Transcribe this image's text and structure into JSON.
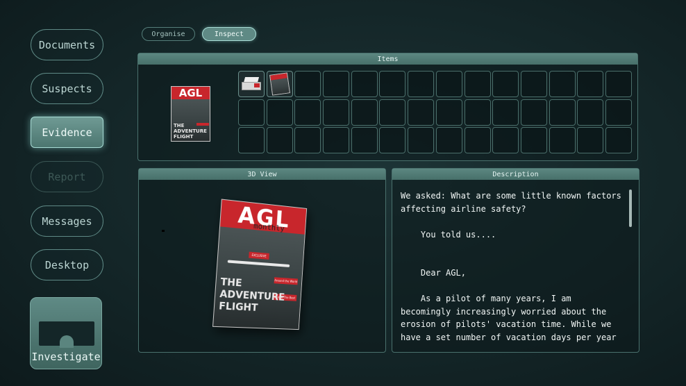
{
  "sidebar": {
    "items": [
      {
        "label": "Documents",
        "state": "normal"
      },
      {
        "label": "Suspects",
        "state": "normal"
      },
      {
        "label": "Evidence",
        "state": "active"
      },
      {
        "label": "Report",
        "state": "disabled"
      },
      {
        "label": "Messages",
        "state": "normal"
      },
      {
        "label": "Desktop",
        "state": "normal"
      }
    ],
    "investigate_label": "Investigate"
  },
  "tabs": {
    "organise": "Organise",
    "inspect": "Inspect",
    "selected": "Inspect"
  },
  "items_panel": {
    "title": "Items",
    "columns": 14,
    "rows": 3,
    "filled": [
      {
        "slot": 0,
        "icon": "printer-icon"
      },
      {
        "slot": 1,
        "icon": "magazine-icon"
      }
    ]
  },
  "magazine": {
    "masthead": "AGL",
    "subtitle": "monthly",
    "headline_1": "THE",
    "headline_2": "ADVENTURE",
    "headline_3": "FLIGHT",
    "tag_exclusive": "EXCLUSIVE",
    "tag_around": "Around the World",
    "tag_above": "Above The Best"
  },
  "view_panel": {
    "title": "3D View"
  },
  "description": {
    "title": "Description",
    "text": "We asked: What are some little known factors affecting airline safety?\n\n    You told us....\n\n\n    Dear AGL,\n\n    As a pilot of many years, I am becomingly increasingly worried about the erosion of pilots' vacation time. While we have a set number of vacation days per year pilots are often made to"
  },
  "colors": {
    "accent": "#5f8a85",
    "glow": "#a9ddd6",
    "magazine_red": "#c8262c"
  }
}
